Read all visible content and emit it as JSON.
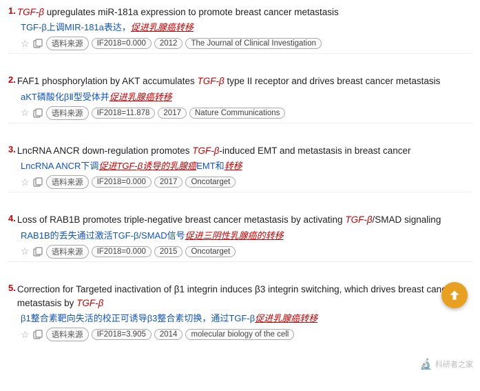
{
  "results": [
    {
      "number": "1.",
      "title_parts": [
        {
          "text": "TGF-β",
          "style": "italic-red"
        },
        {
          "text": " upregulates miR-181a expression to promote breast cancer metastasis",
          "style": "normal"
        }
      ],
      "subtitle_parts": [
        {
          "text": "TGF-β上调MIR-181a表达，",
          "style": "normal-blue"
        },
        {
          "text": "促进乳腺癌转移",
          "style": "underline-red"
        }
      ],
      "meta": {
        "if_label": "IF2018=0.000",
        "year": "2012",
        "journal": "The Journal of Clinical Investigation"
      }
    },
    {
      "number": "2.",
      "title_parts": [
        {
          "text": "FAF1 phosphorylation by AKT accumulates ",
          "style": "normal"
        },
        {
          "text": "TGF-β",
          "style": "italic-red"
        },
        {
          "text": " type II receptor and drives breast cancer metastasis",
          "style": "normal"
        }
      ],
      "subtitle_parts": [
        {
          "text": "aKT磷酸化βⅡ型受体并",
          "style": "normal-blue"
        },
        {
          "text": "促进乳腺癌转移",
          "style": "underline-red"
        }
      ],
      "meta": {
        "if_label": "IF2018=11.878",
        "year": "2017",
        "journal": "Nature Communications"
      }
    },
    {
      "number": "3.",
      "title_parts": [
        {
          "text": "LncRNA ANCR down-regulation promotes ",
          "style": "normal"
        },
        {
          "text": "TGF-β",
          "style": "italic-red"
        },
        {
          "text": "-induced EMT and metastasis in breast cancer",
          "style": "normal"
        }
      ],
      "subtitle_parts": [
        {
          "text": "LncRNA ANCR下调",
          "style": "normal-blue"
        },
        {
          "text": "促进TGF-β诱导的",
          "style": "underline-red"
        },
        {
          "text": "乳腺癌",
          "style": "underline-red"
        },
        {
          "text": "EMT和",
          "style": "normal-blue"
        },
        {
          "text": "转移",
          "style": "underline-red"
        }
      ],
      "meta": {
        "if_label": "IF2018=0.000",
        "year": "2017",
        "journal": "Oncotarget"
      }
    },
    {
      "number": "4.",
      "title_parts": [
        {
          "text": "Loss of RAB1B promotes triple-negative breast cancer metastasis by activating ",
          "style": "normal"
        },
        {
          "text": "TGF-β",
          "style": "italic-red"
        },
        {
          "text": "/SMAD signaling",
          "style": "normal"
        }
      ],
      "subtitle_parts": [
        {
          "text": "RAB1B的丢失通过激活TGF-β/SMAD信号",
          "style": "normal-blue"
        },
        {
          "text": "促进三阴性乳腺癌的",
          "style": "underline-red"
        },
        {
          "text": "转移",
          "style": "underline-red"
        }
      ],
      "meta": {
        "if_label": "IF2018=0.000",
        "year": "2015",
        "journal": "Oncotarget"
      }
    },
    {
      "number": "5.",
      "title_parts": [
        {
          "text": "Correction for Targeted inactivation of β1 integrin induces β3 integrin switching, which drives breast cancer metastasis by ",
          "style": "normal"
        },
        {
          "text": "TGF-β",
          "style": "italic-red"
        }
      ],
      "subtitle_parts": [
        {
          "text": "β1整合素靶向失活的校正可诱导β3整合素切换，通过TGF-β",
          "style": "normal-blue"
        },
        {
          "text": "促进乳腺癌转移",
          "style": "underline-red"
        }
      ],
      "meta": {
        "if_label": "IF2018=3.905",
        "year": "2014",
        "journal": "molecular biology of the cell"
      }
    }
  ],
  "labels": {
    "source": "语料来源",
    "scrollTop": "scroll to top",
    "watermark": "科研者之家"
  }
}
